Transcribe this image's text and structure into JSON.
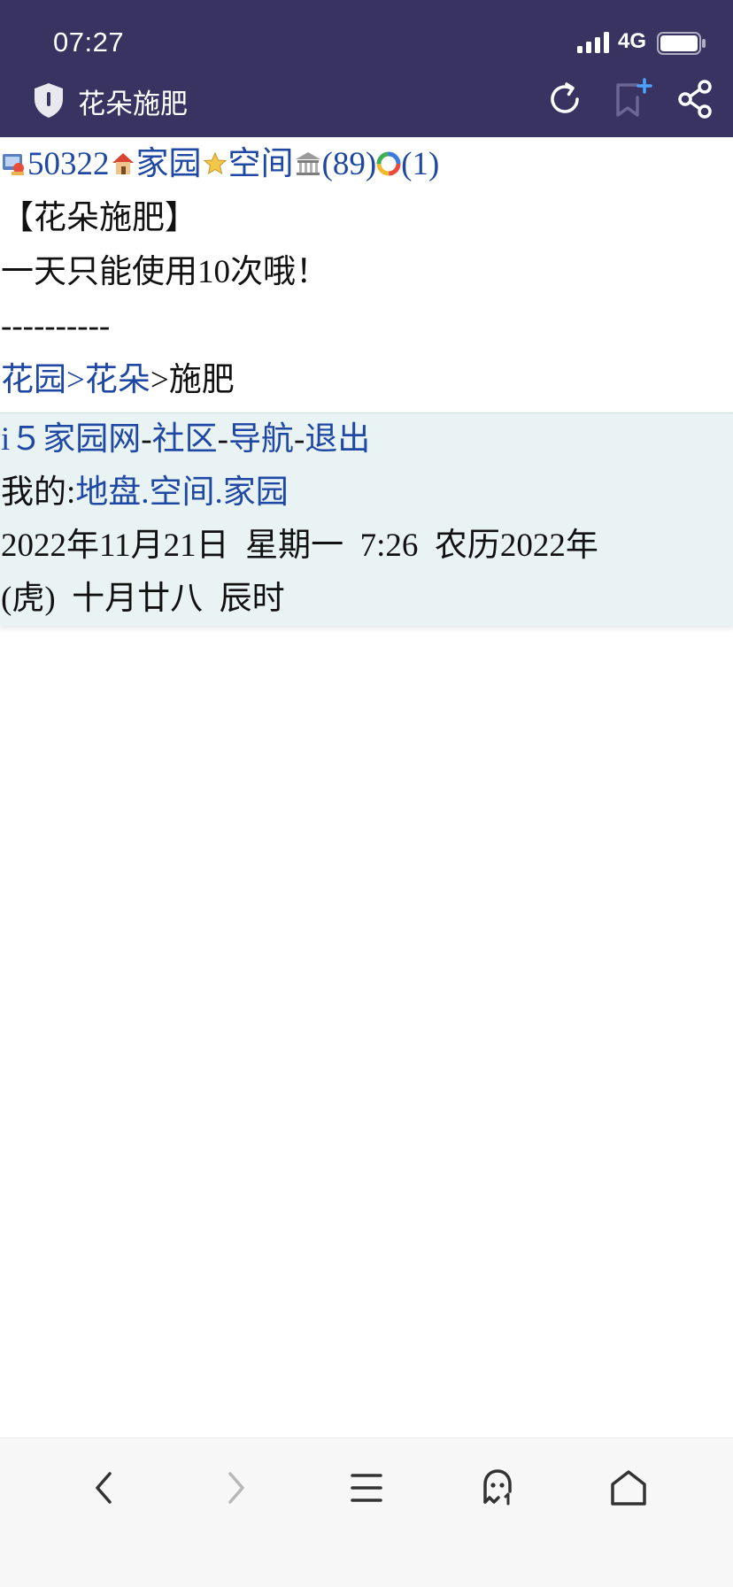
{
  "status_bar": {
    "time": "07:27",
    "network": "4G"
  },
  "browser": {
    "page_title": "花朵施肥"
  },
  "top_nav": {
    "user_id": "50322",
    "home_link": "家园",
    "space_link": "空间",
    "count_1": "(89)",
    "count_2": "(1)"
  },
  "main": {
    "heading": "【花朵施肥】",
    "notice": "一天只能使用10次哦！",
    "divider": "----------",
    "breadcrumb": {
      "garden": "花园",
      "sep1": ">",
      "flower": "花朵",
      "sep2": ">",
      "current": "施肥"
    }
  },
  "footer": {
    "site_link": "i５家园网",
    "sep1": "-",
    "community_link": "社区",
    "sep2": "-",
    "nav_link": "导航",
    "sep3": "-",
    "logout_link": "退出",
    "my_label": "我的:",
    "land_link": "地盘",
    "dot1": ".",
    "space_link": "空间",
    "dot2": ".",
    "home_link": "家园",
    "date_line1": "2022年11月21日  星期一  7:26  农历2022年",
    "date_line2": "(虎)  十月廿八  辰时"
  },
  "icons": {
    "shield": "shield-icon",
    "refresh": "refresh-icon",
    "bookmark_add": "bookmark-add-icon",
    "share": "share-icon",
    "back": "chevron-left-icon",
    "forward": "chevron-right-icon",
    "menu": "menu-icon",
    "ghost": "ghost-icon",
    "home": "home-icon"
  },
  "colors": {
    "chrome_bg": "#383361",
    "link": "#1f48a4",
    "footer_bg": "#e9f3f4"
  }
}
